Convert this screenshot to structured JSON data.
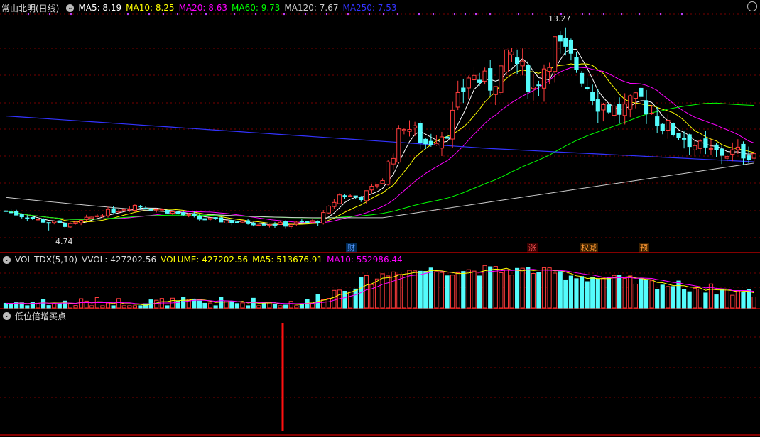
{
  "header": {
    "stock_title": "常山北明(日线)",
    "ma_labels": [
      {
        "text": "MA5: 8.19",
        "color": "#ffffff"
      },
      {
        "text": "MA10: 8.25",
        "color": "#ffff00"
      },
      {
        "text": "MA20: 8.63",
        "color": "#ff00ff"
      },
      {
        "text": "MA60: 9.73",
        "color": "#00ff00"
      },
      {
        "text": "MA120: 7.67",
        "color": "#cccccc"
      },
      {
        "text": "MA250: 7.53",
        "color": "#3333ff"
      }
    ]
  },
  "volume_header": {
    "indicator": "VOL-TDX(5,10)",
    "vvol": "VVOL: 427202.56",
    "volume": "VOLUME: 427202.56",
    "ma5": "MA5: 513676.91",
    "ma10": "MA10: 552986.44"
  },
  "signal_header": {
    "title": "低位倍增买点"
  },
  "markers": [
    {
      "text": "财",
      "color": "#5599ff"
    },
    {
      "text": "涨",
      "color": "#ff5555"
    },
    {
      "text": "权减",
      "color": "#ff9933"
    },
    {
      "text": "预",
      "color": "#ff9933"
    }
  ],
  "price_labels": {
    "high": "13.27",
    "low": "4.74"
  },
  "colors": {
    "up": "#ff3c3c",
    "down": "#54fcfc",
    "grid": "#7a0000",
    "divider": "#b00000"
  },
  "chart_data": {
    "type": "candlestick",
    "title": "常山北明(日线)",
    "price_range": [
      4.2,
      14.3
    ],
    "high_point": 13.27,
    "low_point": 4.74,
    "candle_count": 140,
    "close_anchors": [
      [
        0,
        5.6
      ],
      [
        6,
        5.2
      ],
      [
        12,
        4.95
      ],
      [
        18,
        5.5
      ],
      [
        24,
        5.85
      ],
      [
        30,
        5.6
      ],
      [
        36,
        5.25
      ],
      [
        44,
        5.1
      ],
      [
        52,
        5.0
      ],
      [
        58,
        5.15
      ],
      [
        62,
        6.3
      ],
      [
        66,
        6.2
      ],
      [
        70,
        7.0
      ],
      [
        74,
        9.5
      ],
      [
        78,
        8.6
      ],
      [
        82,
        9.2
      ],
      [
        86,
        11.6
      ],
      [
        90,
        11.2
      ],
      [
        94,
        12.5
      ],
      [
        98,
        11.0
      ],
      [
        102,
        13.0
      ],
      [
        106,
        12.0
      ],
      [
        110,
        10.4
      ],
      [
        114,
        10.0
      ],
      [
        118,
        10.5
      ],
      [
        122,
        9.4
      ],
      [
        126,
        8.9
      ],
      [
        130,
        8.2
      ],
      [
        135,
        8.15
      ],
      [
        139,
        8.19
      ]
    ],
    "ma_values": {
      "MA5": 8.19,
      "MA10": 8.25,
      "MA20": 8.63,
      "MA60": 9.73,
      "MA120": 7.67,
      "MA250": 7.53
    },
    "volume": {
      "last": 427202.56,
      "ma5": 513676.91,
      "ma10": 552986.44
    },
    "signal": {
      "name": "低位倍增买点",
      "index": 64
    }
  }
}
